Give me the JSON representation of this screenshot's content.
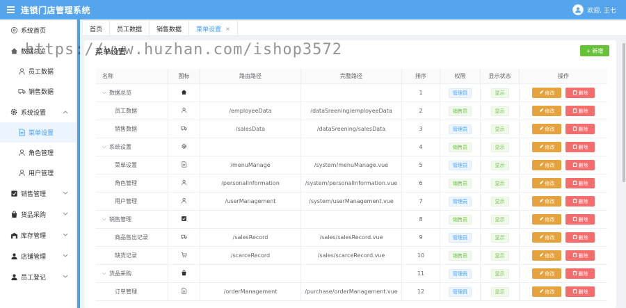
{
  "app": {
    "title": "连锁门店管理系统",
    "welcome": "欢迎, 王七"
  },
  "sidebar": {
    "items": [
      {
        "label": "系统首页",
        "icon": "gear-circle-icon"
      },
      {
        "label": "数据总览",
        "icon": "home-icon"
      },
      {
        "label": "员工数据",
        "icon": "user-icon"
      },
      {
        "label": "销售数据",
        "icon": "truck-icon"
      },
      {
        "label": "系统设置",
        "icon": "gear-icon"
      },
      {
        "label": "菜单设置",
        "icon": "document-icon"
      },
      {
        "label": "角色管理",
        "icon": "user-icon"
      },
      {
        "label": "用户管理",
        "icon": "user-icon"
      },
      {
        "label": "销售管理",
        "icon": "checkbox-icon"
      },
      {
        "label": "货品采购",
        "icon": "bag-icon"
      },
      {
        "label": "库存管理",
        "icon": "warehouse-icon"
      },
      {
        "label": "店铺管理",
        "icon": "user-group-icon"
      },
      {
        "label": "员工登记",
        "icon": "user-icon"
      }
    ]
  },
  "tabs": [
    {
      "label": "首页"
    },
    {
      "label": "员工数据"
    },
    {
      "label": "销售数据"
    },
    {
      "label": "菜单设置",
      "close": "×"
    }
  ],
  "panel": {
    "title": "菜单设置",
    "add_label": "新增",
    "add_icon": "+"
  },
  "table": {
    "headers": [
      "名称",
      "图标",
      "路由路径",
      "完整路径",
      "排序",
      "权限",
      "显示状态",
      "操作"
    ],
    "edit_label": "修改",
    "delete_label": "删除",
    "rows": [
      {
        "name": "数据总览",
        "icon": "home-icon",
        "route": "",
        "full": "",
        "sort": "1",
        "perm": "管理员",
        "show": "显示"
      },
      {
        "name": "员工数据",
        "icon": "user-icon",
        "route": "/employeeData",
        "full": "/dataSreening/employeeData",
        "sort": "2",
        "perm": "销售员",
        "show": "显示"
      },
      {
        "name": "销售数据",
        "icon": "truck-icon",
        "route": "/salesData",
        "full": "/dataSreening/salesData",
        "sort": "3",
        "perm": "管理员",
        "show": "显示"
      },
      {
        "name": "系统设置",
        "icon": "gear-icon",
        "route": "",
        "full": "",
        "sort": "4",
        "perm": "销售员",
        "show": "显示"
      },
      {
        "name": "菜单设置",
        "icon": "document-icon",
        "route": "/menuManage",
        "full": "/system/menuManage.vue",
        "sort": "5",
        "perm": "管理员",
        "show": "显示"
      },
      {
        "name": "角色管理",
        "icon": "user-icon",
        "route": "/personalInformation",
        "full": "/system/personalInformation.vue",
        "sort": "6",
        "perm": "销售员",
        "show": "显示"
      },
      {
        "name": "用户管理",
        "icon": "user-icon",
        "route": "/userManagement",
        "full": "/system/userManagement.vue",
        "sort": "7",
        "perm": "管理员",
        "show": "显示"
      },
      {
        "name": "销售管理",
        "icon": "checkbox-icon",
        "route": "",
        "full": "",
        "sort": "8",
        "perm": "销售员",
        "show": "显示"
      },
      {
        "name": "商品售出记录",
        "icon": "truck-icon",
        "route": "/salesRecord",
        "full": "/sales/salesRecord.vue",
        "sort": "9",
        "perm": "管理员",
        "show": "显示"
      },
      {
        "name": "缺货记录",
        "icon": "cart-icon",
        "route": "/scarceRecord",
        "full": "/sales/scarceRecord.vue",
        "sort": "10",
        "perm": "销售员",
        "show": "显示"
      },
      {
        "name": "货品采购",
        "icon": "bag-icon",
        "route": "",
        "full": "",
        "sort": "11",
        "perm": "管理员",
        "show": "显示"
      },
      {
        "name": "订单管理",
        "icon": "document-icon",
        "route": "/orderManagement",
        "full": "/purchase/orderManagement.vue",
        "sort": "12",
        "perm": "管理员",
        "show": "显示"
      }
    ]
  },
  "watermark": "https://www.huzhan.com/ishop3572",
  "colors": {
    "header": "#55a5ec",
    "primary": "#409eff",
    "success": "#67c23a",
    "warning": "#e6a23c",
    "danger": "#f56c6c"
  }
}
